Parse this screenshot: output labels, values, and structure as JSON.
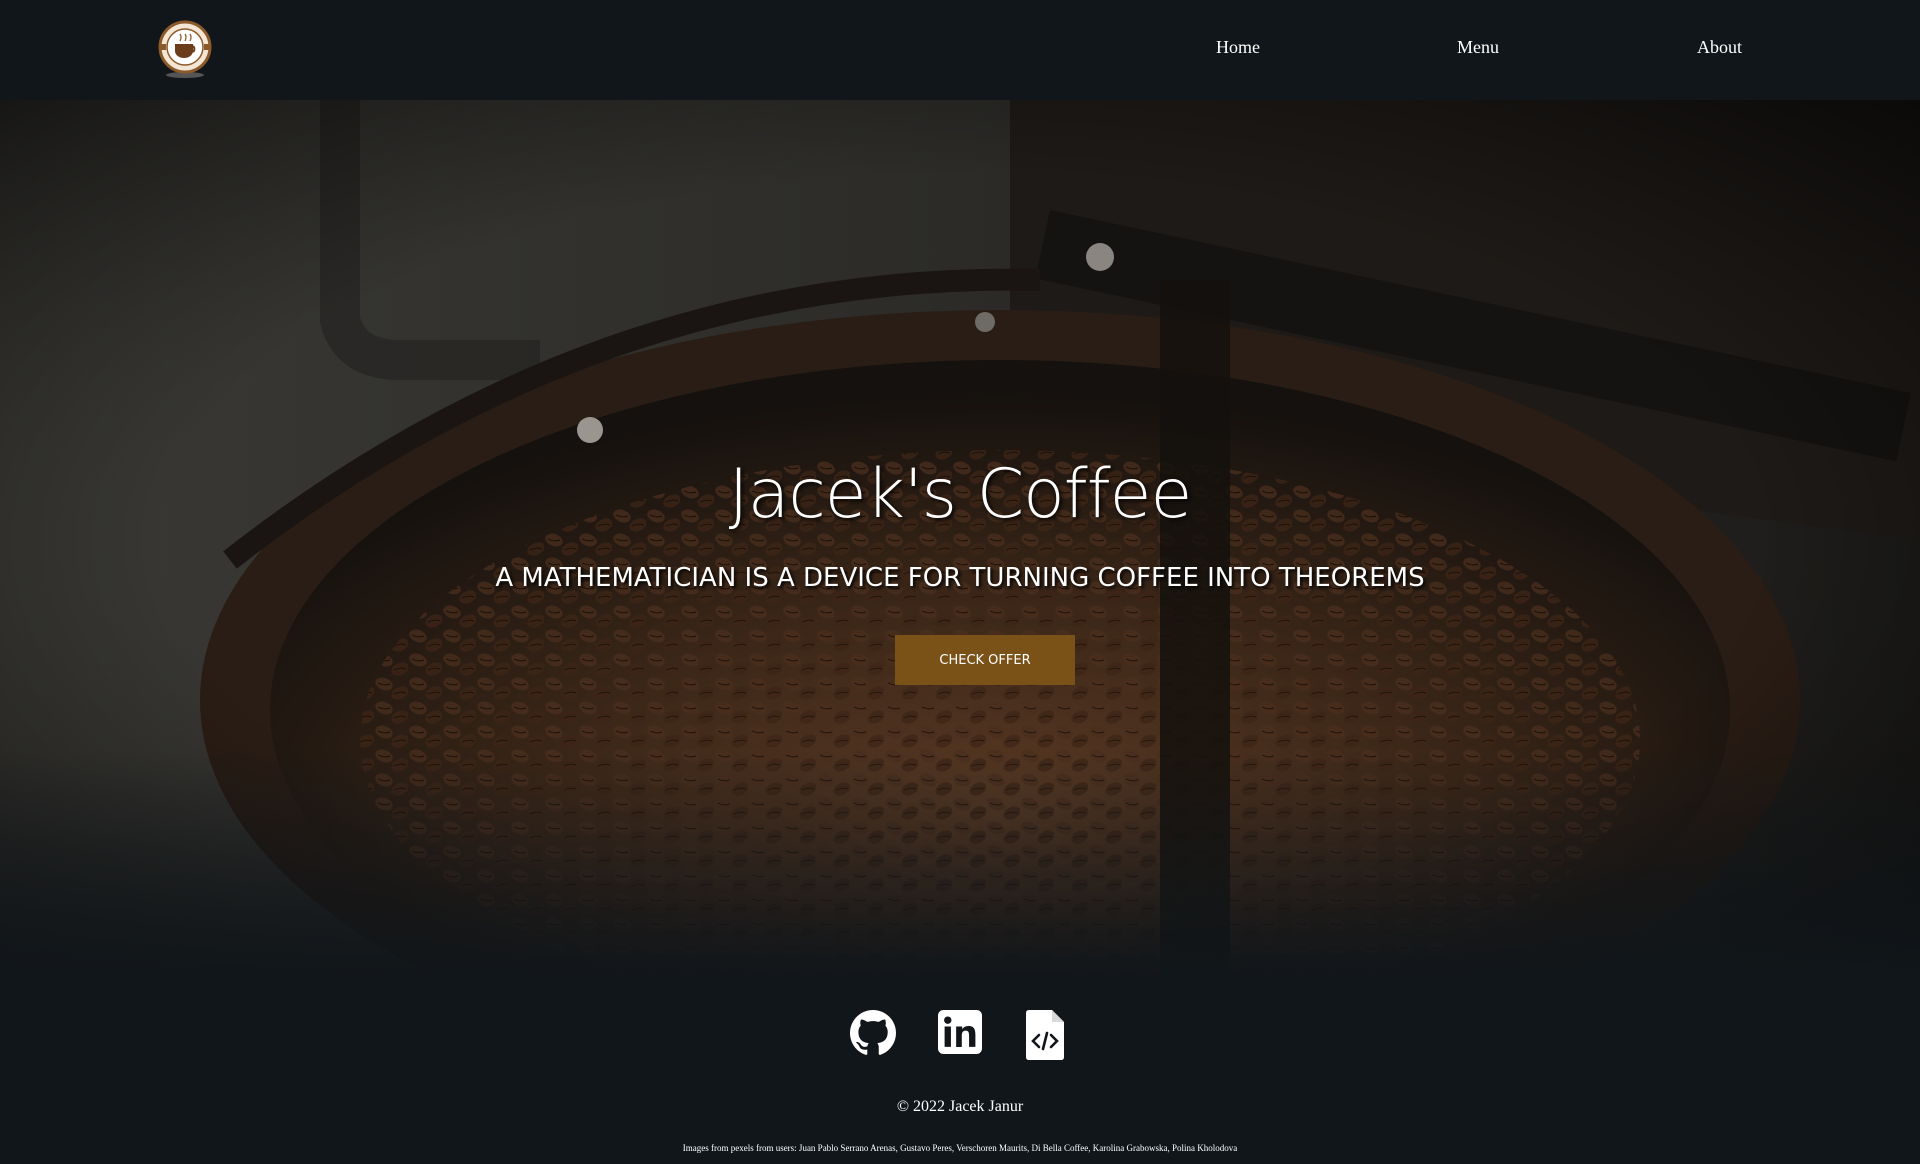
{
  "nav": {
    "home": "Home",
    "menu": "Menu",
    "about": "About"
  },
  "hero": {
    "title": "Jacek's Coffee",
    "subtitle": "A MATHEMATICIAN IS A DEVICE FOR TURNING COFFEE INTO THEOREMS",
    "cta_label": "CHECK OFFER"
  },
  "footer": {
    "social_icons": [
      "github-icon",
      "linkedin-icon",
      "code-file-icon"
    ],
    "copyright": "© 2022 Jacek Janur",
    "credits": "Images from pexels from users: Juan Pablo Serrano Arenas, Gustavo Peres, Verschoren Maurits, Di Bella Coffee, Karolina Grabowska, Polina Kholodova"
  },
  "colors": {
    "background": "#11161a",
    "accent": "#7a5218"
  }
}
